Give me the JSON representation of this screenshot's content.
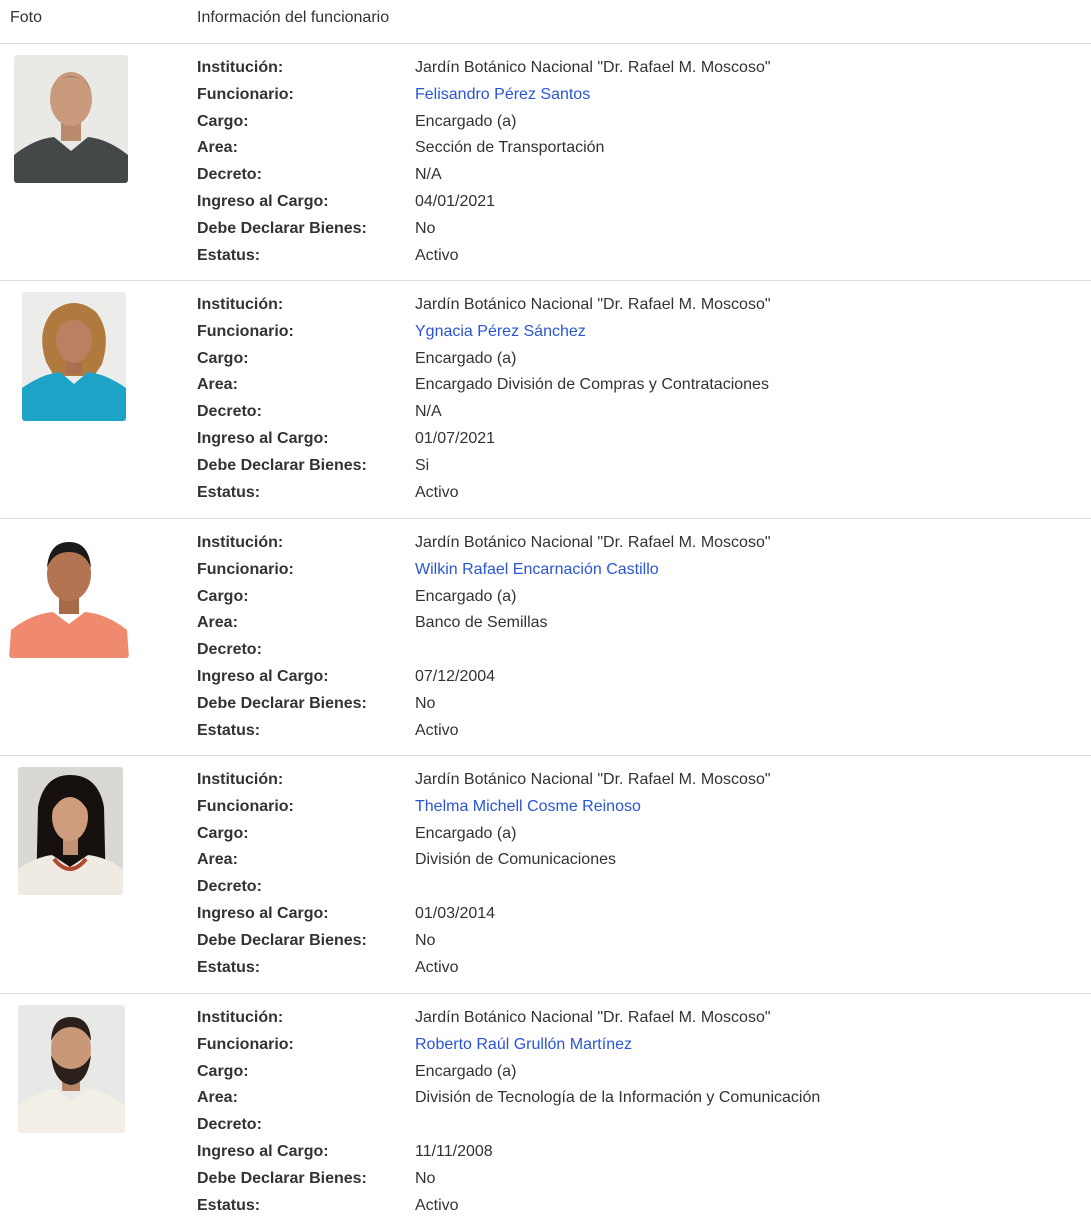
{
  "header": {
    "foto": "Foto",
    "info": "Información del funcionario"
  },
  "labels": {
    "institucion": "Institución:",
    "funcionario": "Funcionario:",
    "cargo": "Cargo:",
    "area": "Area:",
    "decreto": "Decreto:",
    "ingreso": "Ingreso al Cargo:",
    "declarar": "Debe Declarar Bienes:",
    "estatus": "Estatus:"
  },
  "colors": {
    "link": "#2a54d6",
    "border": "#dddddd",
    "text": "#333333"
  },
  "rows": [
    {
      "photo_icon": "employee-photo-man-gray-shirt",
      "institucion": "Jardín Botánico Nacional \"Dr. Rafael M. Moscoso\"",
      "funcionario": "Felisandro Pérez Santos",
      "cargo": "Encargado (a)",
      "area": "Sección de Transportación",
      "decreto": "N/A",
      "ingreso": "04/01/2021",
      "declarar": "No",
      "estatus": "Activo"
    },
    {
      "photo_icon": "employee-photo-woman-blue-shirt",
      "institucion": "Jardín Botánico Nacional \"Dr. Rafael M. Moscoso\"",
      "funcionario": "Ygnacia Pérez Sánchez",
      "cargo": "Encargado (a)",
      "area": "Encargado División de Compras y Contrataciones",
      "decreto": "N/A",
      "ingreso": "01/07/2021",
      "declarar": "Si",
      "estatus": "Activo"
    },
    {
      "photo_icon": "employee-photo-man-salmon-shirt",
      "institucion": "Jardín Botánico Nacional \"Dr. Rafael M. Moscoso\"",
      "funcionario": "Wilkin Rafael Encarnación Castillo",
      "cargo": "Encargado (a)",
      "area": "Banco de Semillas",
      "decreto": "",
      "ingreso": "07/12/2004",
      "declarar": "No",
      "estatus": "Activo"
    },
    {
      "photo_icon": "employee-photo-woman-white-blazer",
      "institucion": "Jardín Botánico Nacional \"Dr. Rafael M. Moscoso\"",
      "funcionario": "Thelma Michell Cosme Reinoso",
      "cargo": "Encargado (a)",
      "area": "División de Comunicaciones",
      "decreto": "",
      "ingreso": "01/03/2014",
      "declarar": "No",
      "estatus": "Activo"
    },
    {
      "photo_icon": "employee-photo-man-beard-white-shirt",
      "institucion": "Jardín Botánico Nacional \"Dr. Rafael M. Moscoso\"",
      "funcionario": "Roberto Raúl Grullón Martínez",
      "cargo": "Encargado (a)",
      "area": "División de Tecnología de la Información y Comunicación",
      "decreto": "",
      "ingreso": "11/11/2008",
      "declarar": "No",
      "estatus": "Activo"
    }
  ]
}
